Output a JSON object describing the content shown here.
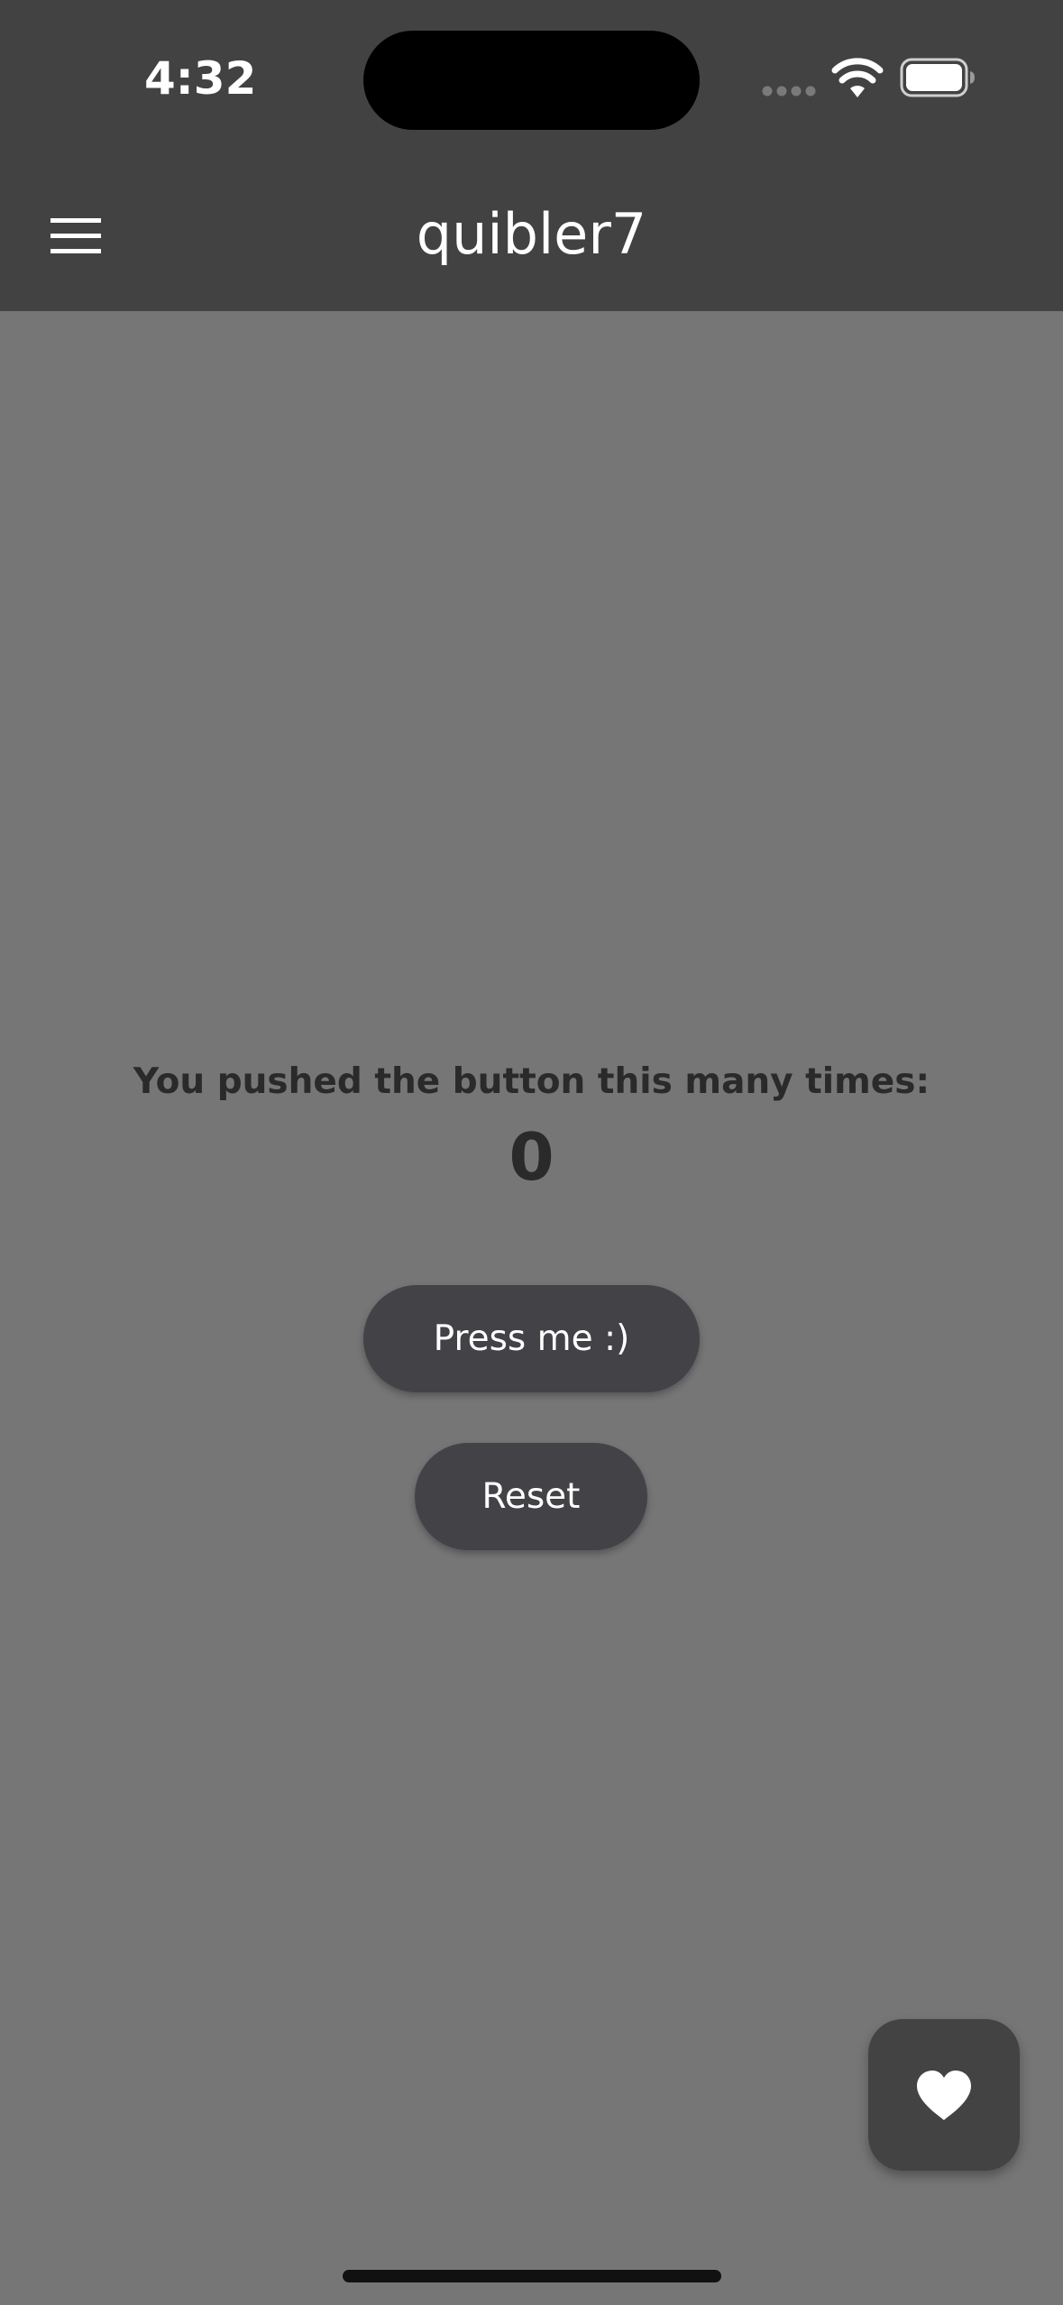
{
  "status_bar": {
    "time": "4:32",
    "signal_icon": "cellular-signal-icon",
    "wifi_icon": "wifi-icon",
    "battery_icon": "battery-icon"
  },
  "app_bar": {
    "menu_icon": "hamburger-menu-icon",
    "title": "quibler7",
    "background": "#424242"
  },
  "main": {
    "counter_label": "You pushed the button this many times:",
    "counter_value": "0",
    "press_button_label": "Press me :)",
    "reset_button_label": "Reset",
    "background": "#767676",
    "button_color": "#434247"
  },
  "fab": {
    "icon": "heart-icon"
  }
}
